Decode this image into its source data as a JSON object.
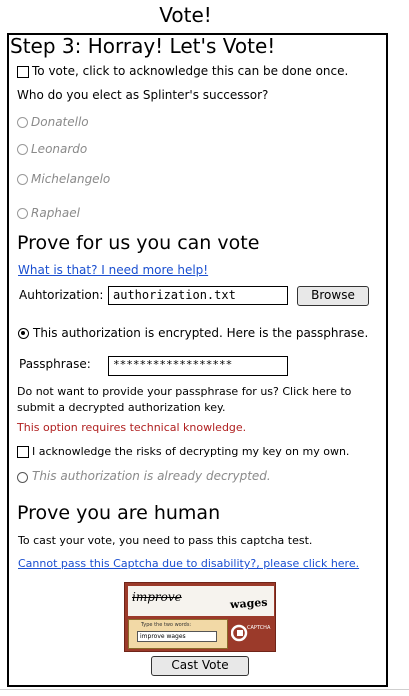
{
  "page": {
    "title": "Vote!",
    "step_heading": "Step 3: Horray! Let's Vote!"
  },
  "acknowledge": {
    "checkbox_label": "To vote, click to acknowledge this can be done once.",
    "question": "Who do you elect as Splinter's successor?",
    "candidates": [
      "Donatello",
      "Leonardo",
      "Michelangelo",
      "Raphael"
    ]
  },
  "prove_vote": {
    "heading": "Prove for us you can vote",
    "help_link": "What is that? I need more help!",
    "auth_label": "Auhtorization:",
    "auth_value": "authorization.txt",
    "browse_label": "Browse",
    "encrypted_option": "This authorization is encrypted. Here is the passphrase.",
    "passphrase_label": "Passphrase:",
    "passphrase_value": "******************",
    "decrypt_note_line1": "Do not want to provide your passphrase for us? Click here to",
    "decrypt_note_line2": "submit a decrypted authorization key.",
    "warning": "This option requires technical knowledge.",
    "risk_checkbox_label": "I acknowledge the risks of decrypting my key on my own.",
    "decrypted_option": "This authorization is already decrypted."
  },
  "prove_human": {
    "heading": "Prove you are human",
    "instructions": "To cast your vote, you need to pass this captcha test.",
    "disability_link": "Cannot pass this Captcha due to disability?, please click here.",
    "captcha": {
      "word1": "improve",
      "word2": "wages",
      "hint": "Type the two words:",
      "input_value": "improve wages",
      "logo_text": "CAPTCHA"
    },
    "cast_button": "Cast Vote"
  },
  "colors": {
    "link": "#1a4fd0",
    "warning": "#b02020",
    "disabled": "#8a8a8a",
    "captcha_frame": "#9b3a2a"
  }
}
